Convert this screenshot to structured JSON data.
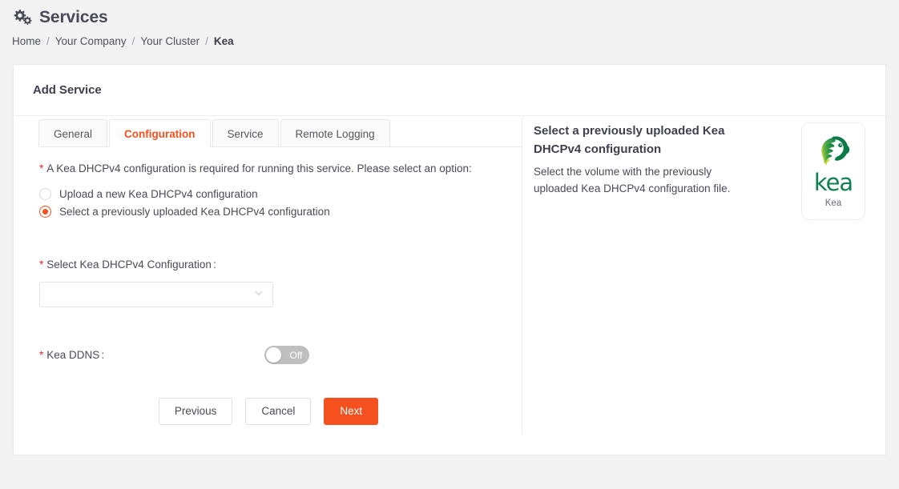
{
  "header": {
    "title": "Services",
    "icon": "gears-icon"
  },
  "breadcrumb": {
    "items": [
      {
        "label": "Home",
        "current": false
      },
      {
        "label": "Your Company",
        "current": false
      },
      {
        "label": "Your Cluster",
        "current": false
      },
      {
        "label": "Kea",
        "current": true
      }
    ],
    "separator": "/"
  },
  "card": {
    "title": "Add Service"
  },
  "tabs": [
    {
      "label": "General",
      "active": false
    },
    {
      "label": "Configuration",
      "active": true
    },
    {
      "label": "Service",
      "active": false
    },
    {
      "label": "Remote Logging",
      "active": false
    }
  ],
  "form": {
    "required_marker": "*",
    "prompt": "A Kea DHCPv4 configuration is required for running this service. Please select an option:",
    "options": [
      {
        "label": "Upload a new Kea DHCPv4 configuration",
        "selected": false
      },
      {
        "label": "Select a previously uploaded Kea DHCPv4 configuration",
        "selected": true
      }
    ],
    "select_field": {
      "label": "Select Kea DHCPv4 Configuration :",
      "value": "",
      "placeholder": "",
      "icon": "chevron-down-icon"
    },
    "ddns_field": {
      "label": "Kea DDNS :",
      "state_label": "Off",
      "on": false
    }
  },
  "buttons": {
    "previous": "Previous",
    "cancel": "Cancel",
    "next": "Next"
  },
  "help": {
    "title": "Select a previously uploaded Kea DHCPv4 configuration",
    "body": "Select the volume with the previously uploaded Kea DHCPv4 configuration file.",
    "logo_word": "kea",
    "logo_caption": "Kea"
  },
  "colors": {
    "accent": "#f4511e",
    "required": "#f5222d",
    "page_bg": "#f2f2f2",
    "card_bg": "#ffffff",
    "text": "#4a4a57",
    "toggle_off": "#bfbfbf",
    "kea_green": "#108050"
  }
}
